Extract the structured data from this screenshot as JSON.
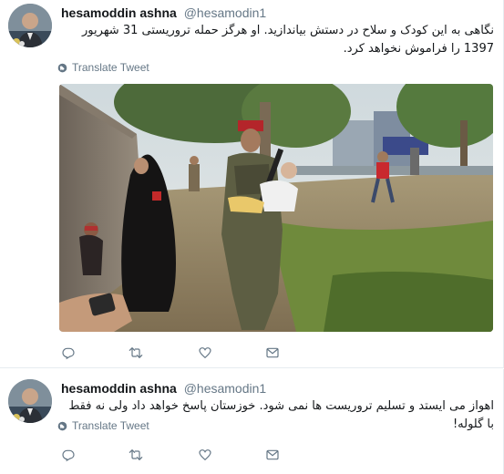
{
  "tweets": [
    {
      "display_name": "hesamoddin ashna",
      "handle": "@hesamodin1",
      "text": "نگاهی به این کودک و سلاح در دستش بیاندازید. او هرگز حمله تروریستی 31 شهریور 1397 را فراموش نخواهد کرد.",
      "translate_label": "Translate Tweet",
      "has_media": true
    },
    {
      "display_name": "hesamoddin ashna",
      "handle": "@hesamodin1",
      "text": "اهواز می ایستد و تسلیم تروریست ها نمی شود. خوزستان پاسخ خواهد داد ولی نه فقط با گلوله!",
      "translate_label": "Translate Tweet",
      "has_media": false
    }
  ],
  "icons": {
    "reply": "reply-icon",
    "retweet": "retweet-icon",
    "like": "heart-icon",
    "dm": "direct-message-icon",
    "globe": "globe-icon"
  },
  "colors": {
    "text": "#14171a",
    "secondary": "#657786",
    "divider": "#e6ecf0"
  }
}
